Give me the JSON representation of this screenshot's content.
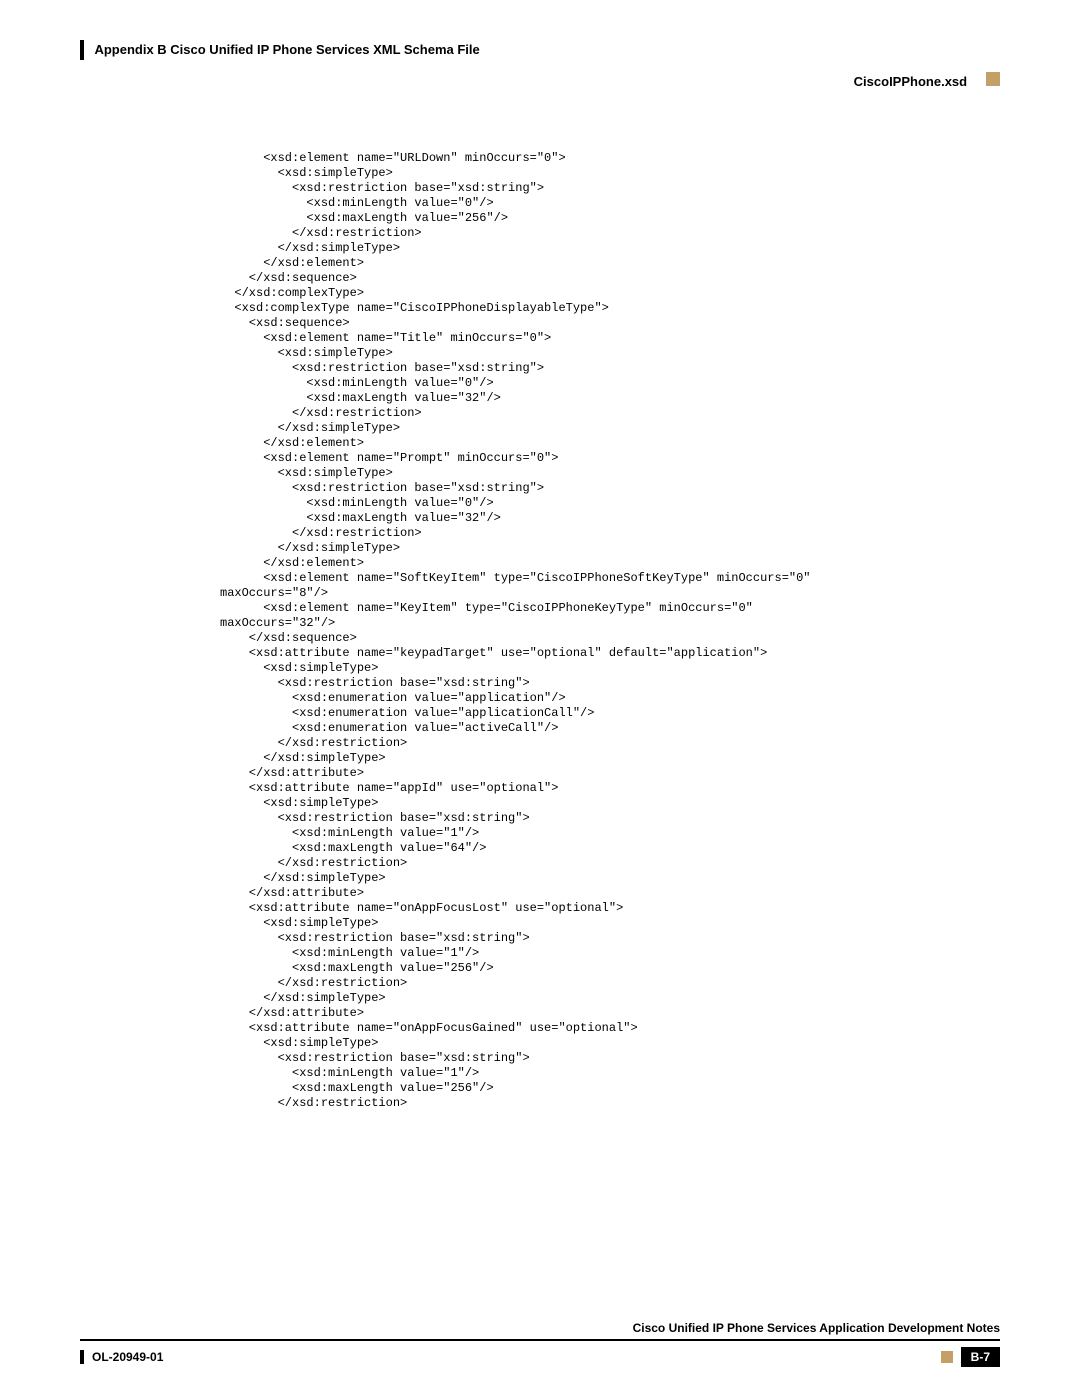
{
  "header": {
    "appendix": "Appendix B    Cisco Unified IP Phone Services XML Schema File",
    "section": "CiscoIPPhone.xsd"
  },
  "code": {
    "lines": [
      "      <xsd:element name=\"URLDown\" minOccurs=\"0\">",
      "        <xsd:simpleType>",
      "          <xsd:restriction base=\"xsd:string\">",
      "            <xsd:minLength value=\"0\"/>",
      "            <xsd:maxLength value=\"256\"/>",
      "          </xsd:restriction>",
      "        </xsd:simpleType>",
      "      </xsd:element>",
      "    </xsd:sequence>",
      "  </xsd:complexType>",
      "  <xsd:complexType name=\"CiscoIPPhoneDisplayableType\">",
      "    <xsd:sequence>",
      "      <xsd:element name=\"Title\" minOccurs=\"0\">",
      "        <xsd:simpleType>",
      "          <xsd:restriction base=\"xsd:string\">",
      "            <xsd:minLength value=\"0\"/>",
      "            <xsd:maxLength value=\"32\"/>",
      "          </xsd:restriction>",
      "        </xsd:simpleType>",
      "      </xsd:element>",
      "      <xsd:element name=\"Prompt\" minOccurs=\"0\">",
      "        <xsd:simpleType>",
      "          <xsd:restriction base=\"xsd:string\">",
      "            <xsd:minLength value=\"0\"/>",
      "            <xsd:maxLength value=\"32\"/>",
      "          </xsd:restriction>",
      "        </xsd:simpleType>",
      "      </xsd:element>",
      "      <xsd:element name=\"SoftKeyItem\" type=\"CiscoIPPhoneSoftKeyType\" minOccurs=\"0\" ",
      "maxOccurs=\"8\"/>",
      "      <xsd:element name=\"KeyItem\" type=\"CiscoIPPhoneKeyType\" minOccurs=\"0\" ",
      "maxOccurs=\"32\"/>",
      "    </xsd:sequence>",
      "    <xsd:attribute name=\"keypadTarget\" use=\"optional\" default=\"application\">",
      "      <xsd:simpleType>",
      "        <xsd:restriction base=\"xsd:string\">",
      "          <xsd:enumeration value=\"application\"/>",
      "          <xsd:enumeration value=\"applicationCall\"/>",
      "          <xsd:enumeration value=\"activeCall\"/>",
      "        </xsd:restriction>",
      "      </xsd:simpleType>",
      "    </xsd:attribute>",
      "    <xsd:attribute name=\"appId\" use=\"optional\">",
      "      <xsd:simpleType>",
      "        <xsd:restriction base=\"xsd:string\">",
      "          <xsd:minLength value=\"1\"/>",
      "          <xsd:maxLength value=\"64\"/>",
      "        </xsd:restriction>",
      "      </xsd:simpleType>",
      "    </xsd:attribute>",
      "    <xsd:attribute name=\"onAppFocusLost\" use=\"optional\">",
      "      <xsd:simpleType>",
      "        <xsd:restriction base=\"xsd:string\">",
      "          <xsd:minLength value=\"1\"/>",
      "          <xsd:maxLength value=\"256\"/>",
      "        </xsd:restriction>",
      "      </xsd:simpleType>",
      "    </xsd:attribute>",
      "    <xsd:attribute name=\"onAppFocusGained\" use=\"optional\">",
      "      <xsd:simpleType>",
      "        <xsd:restriction base=\"xsd:string\">",
      "          <xsd:minLength value=\"1\"/>",
      "          <xsd:maxLength value=\"256\"/>",
      "        </xsd:restriction>"
    ]
  },
  "footer": {
    "doc_title": "Cisco Unified IP Phone Services Application Development Notes",
    "doc_id": "OL-20949-01",
    "page": "B-7"
  }
}
